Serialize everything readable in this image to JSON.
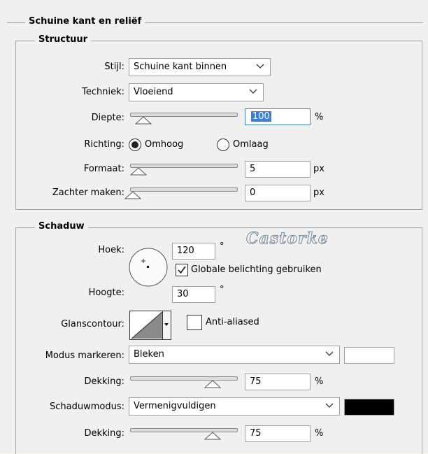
{
  "title": "Schuine kant en reliëf",
  "structuur": {
    "legend": "Structuur",
    "stijl": {
      "label": "Stijl:",
      "value": "Schuine kant binnen"
    },
    "techniek": {
      "label": "Techniek:",
      "value": "Vloeiend"
    },
    "diepte": {
      "label": "Diepte:",
      "value": "100",
      "unit": "%",
      "slider_fraction": 0.1
    },
    "richting": {
      "label": "Richting:",
      "options": [
        "Omhoog",
        "Omlaag"
      ],
      "selected": "Omhoog"
    },
    "formaat": {
      "label": "Formaat:",
      "value": "5",
      "unit": "px",
      "slider_fraction": 0.05
    },
    "zachter": {
      "label": "Zachter maken:",
      "value": "0",
      "unit": "px",
      "slider_fraction": 0.0
    }
  },
  "schaduw": {
    "legend": "Schaduw",
    "watermark": "Castorke",
    "hoek": {
      "label": "Hoek:",
      "value": "120",
      "unit": "°"
    },
    "globale": {
      "label": "Globale belichting gebruiken",
      "checked": true
    },
    "hoogte": {
      "label": "Hoogte:",
      "value": "30",
      "unit": "°"
    },
    "glanscontour": {
      "label": "Glanscontour:"
    },
    "anti_aliased": {
      "label": "Anti-aliased",
      "checked": false
    },
    "modus_markeren": {
      "label": "Modus markeren:",
      "value": "Bleken",
      "color": "#ffffff"
    },
    "dekking1": {
      "label": "Dekking:",
      "value": "75",
      "unit": "%",
      "slider_fraction": 0.75
    },
    "schaduwmodus": {
      "label": "Schaduwmodus:",
      "value": "Vermenigvuldigen",
      "color": "#000000"
    },
    "dekking2": {
      "label": "Dekking:",
      "value": "75",
      "unit": "%",
      "slider_fraction": 0.75
    }
  },
  "colors": {
    "panel": "#f0f0f0",
    "border": "#fbf7df",
    "focus": "#3c7fd6"
  }
}
